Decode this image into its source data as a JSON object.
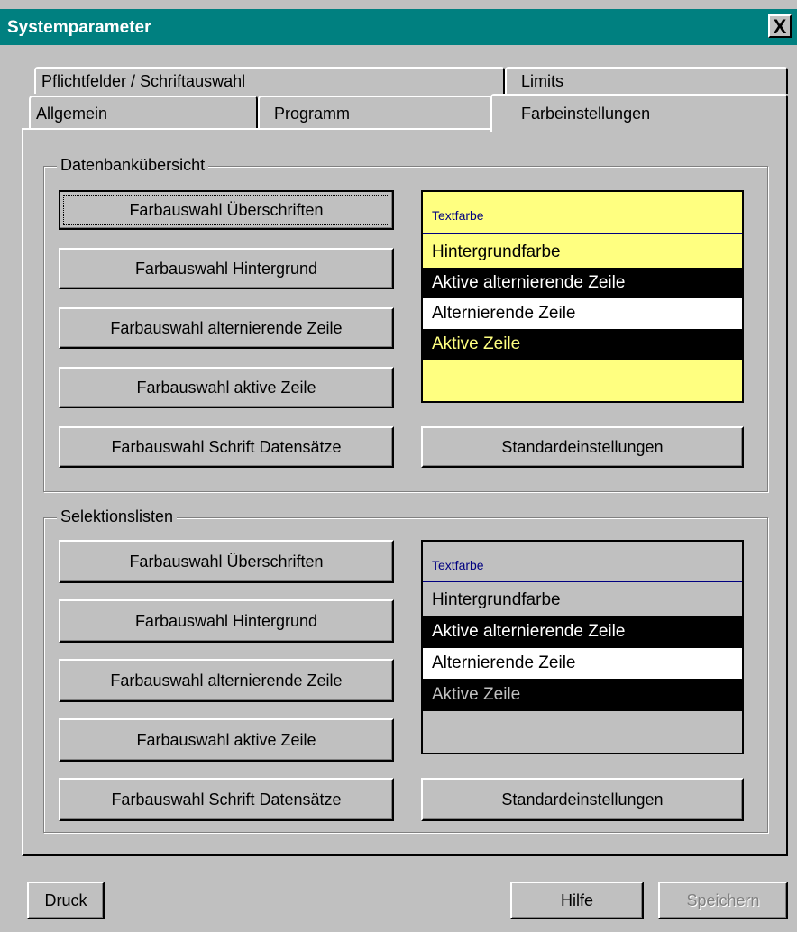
{
  "window": {
    "title": "Systemparameter",
    "close_label": "X"
  },
  "tabs": {
    "row1": [
      "Pflichtfelder / Schriftauswahl",
      "Limits"
    ],
    "row2": [
      "Allgemein",
      "Programm",
      "Farbeinstellungen"
    ]
  },
  "group1": {
    "label": "Datenbankübersicht",
    "buttons": [
      "Farbauswahl Überschriften",
      "Farbauswahl Hintergrund",
      "Farbauswahl alternierende Zeile",
      "Farbauswahl aktive Zeile",
      "Farbauswahl Schrift Datensätze"
    ],
    "standard_button": "Standardeinstellungen",
    "preview": {
      "header": "Textfarbe",
      "rows": [
        "Hintergrundfarbe",
        "Aktive alternierende Zeile",
        "Alternierende Zeile",
        "Aktive Zeile"
      ],
      "colors": {
        "background": "#ffff80",
        "active_alt_bg": "#000000",
        "active_alt_fg": "#ffffff",
        "alt_bg": "#ffffff",
        "active_bg": "#000000",
        "active_fg": "#ffff80"
      }
    }
  },
  "group2": {
    "label": "Selektionslisten",
    "buttons": [
      "Farbauswahl Überschriften",
      "Farbauswahl Hintergrund",
      "Farbauswahl alternierende Zeile",
      "Farbauswahl aktive Zeile",
      "Farbauswahl Schrift Datensätze"
    ],
    "standard_button": "Standardeinstellungen",
    "preview": {
      "header": "Textfarbe",
      "rows": [
        "Hintergrundfarbe",
        "Aktive alternierende Zeile",
        "Alternierende Zeile",
        "Aktive Zeile"
      ],
      "colors": {
        "background": "#c0c0c0",
        "header_line": "#000080",
        "active_alt_bg": "#000000",
        "active_alt_fg": "#ffffff",
        "alt_bg": "#ffffff",
        "active_bg": "#000000",
        "active_fg": "#c0c0c0"
      }
    }
  },
  "footer": {
    "print": "Druck",
    "help": "Hilfe",
    "save": "Speichern"
  },
  "colors": {
    "titlebar": "#008080",
    "face": "#c0c0c0"
  }
}
